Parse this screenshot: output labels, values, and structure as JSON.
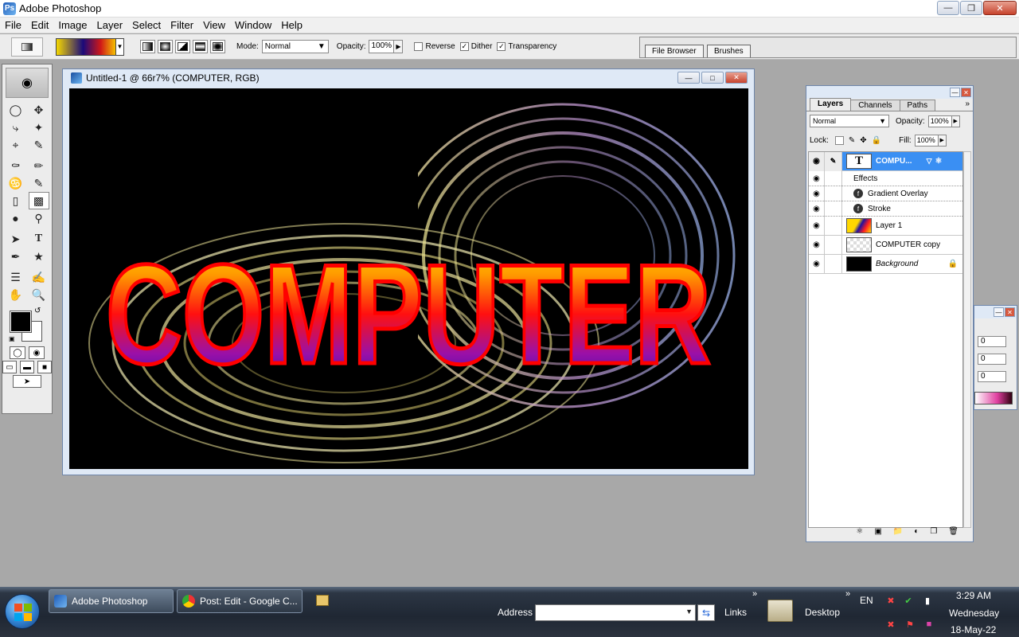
{
  "window": {
    "title": "Adobe Photoshop"
  },
  "menu": [
    "File",
    "Edit",
    "Image",
    "Layer",
    "Select",
    "Filter",
    "View",
    "Window",
    "Help"
  ],
  "options": {
    "mode_label": "Mode:",
    "mode_value": "Normal",
    "opacity_label": "Opacity:",
    "opacity_value": "100%",
    "reverse_label": "Reverse",
    "dither_label": "Dither",
    "transparency_label": "Transparency",
    "reverse_checked": false,
    "dither_checked": true,
    "transparency_checked": true
  },
  "palette_well": {
    "tabs": [
      "File Browser",
      "Brushes"
    ]
  },
  "document": {
    "title": "Untitled-1 @ 66r7% (COMPUTER, RGB)",
    "text_art": "COMPUTER"
  },
  "layers_palette": {
    "tabs": [
      "Layers",
      "Channels",
      "Paths"
    ],
    "blend_mode": "Normal",
    "opacity_label": "Opacity:",
    "opacity_value": "100%",
    "lock_label": "Lock:",
    "fill_label": "Fill:",
    "fill_value": "100%",
    "layers": [
      {
        "name": "COMPU...",
        "selected": true
      },
      {
        "name": "Layer 1",
        "selected": false
      },
      {
        "name": "COMPUTER copy",
        "selected": false
      },
      {
        "name": "Background",
        "selected": false
      }
    ],
    "effects_label": "Effects",
    "effects": [
      "Gradient Overlay",
      "Stroke"
    ]
  },
  "side_palette": {
    "fields": [
      "0",
      "0",
      "0"
    ]
  },
  "taskbar": {
    "tasks": [
      "Adobe Photoshop",
      "Post: Edit - Google C..."
    ],
    "address_label": "Address",
    "links_label": "Links",
    "desktop_label": "Desktop",
    "language": "EN",
    "time": "3:29 AM",
    "day": "Wednesday",
    "date": "18-May-22"
  },
  "colors": {
    "accent": "#3a8ff3",
    "foreground_color": "#000000",
    "background_color": "#ffffff"
  }
}
